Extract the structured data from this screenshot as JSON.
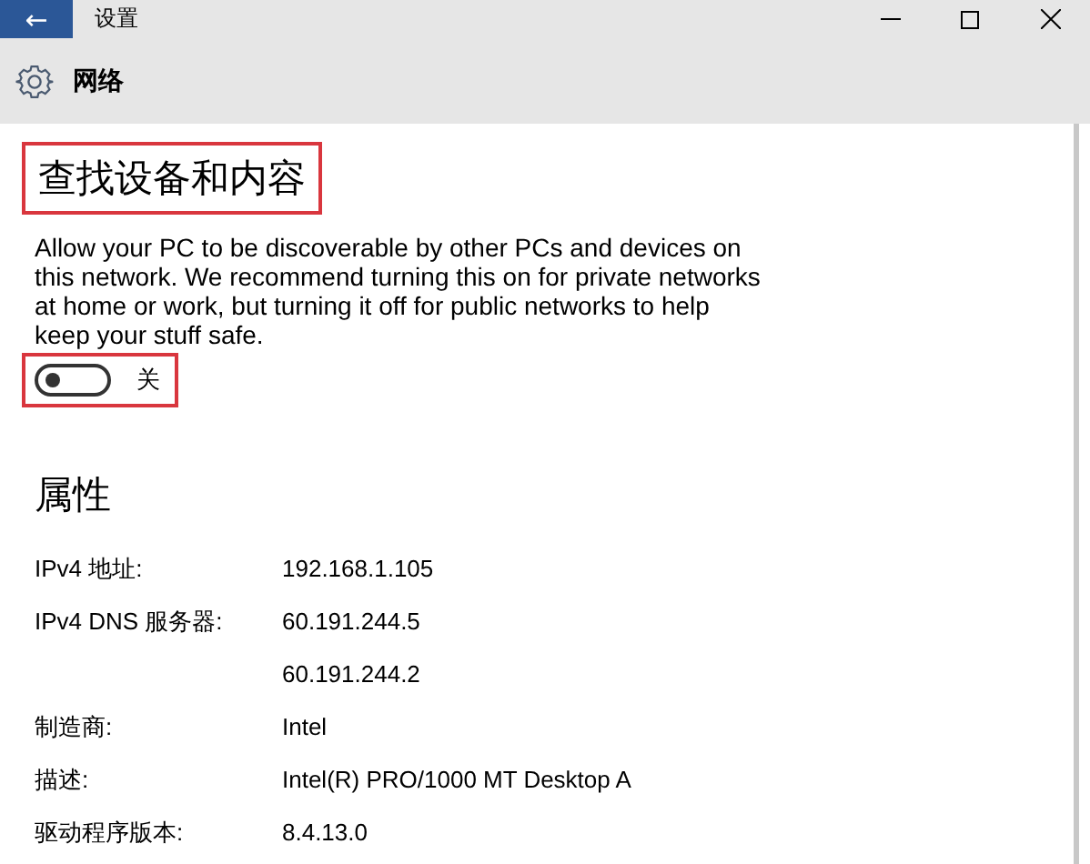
{
  "window": {
    "title": "设置",
    "back": "←"
  },
  "header": {
    "title": "网络"
  },
  "discovery": {
    "heading": "查找设备和内容",
    "highlighted": true,
    "description": "Allow your PC to be discoverable by other PCs and devices on this network. We recommend turning this on for private networks at home or work, but turning it off for public networks to help keep your stuff safe.",
    "toggle": {
      "on": false,
      "label": "关",
      "highlighted": true
    }
  },
  "properties": {
    "heading": "属性",
    "rows": [
      {
        "label": "IPv4 地址:",
        "value": "192.168.1.105"
      },
      {
        "label": "IPv4 DNS 服务器:",
        "value": "60.191.244.5"
      },
      {
        "label": "",
        "value": "60.191.244.2"
      },
      {
        "label": "制造商:",
        "value": "Intel"
      },
      {
        "label": "描述:",
        "value": "Intel(R) PRO/1000 MT Desktop A"
      },
      {
        "label": "驱动程序版本:",
        "value": "8.4.13.0"
      }
    ]
  }
}
